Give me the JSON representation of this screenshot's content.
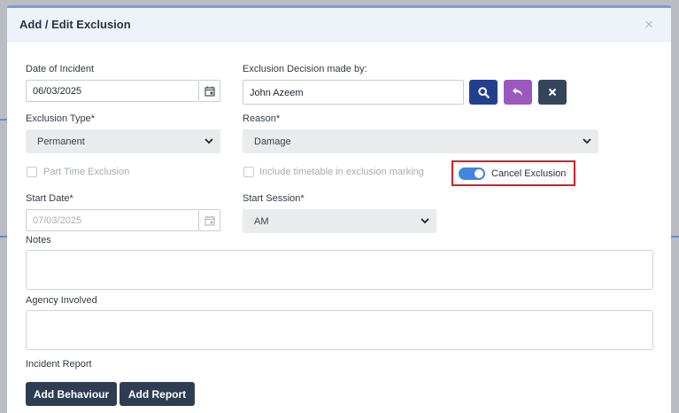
{
  "modal": {
    "title": "Add / Edit Exclusion",
    "close_symbol": "×"
  },
  "form": {
    "date_of_incident": {
      "label": "Date of Incident",
      "value": "06/03/2025"
    },
    "decision_made_by": {
      "label": "Exclusion Decision made by:",
      "value": "John Azeem"
    },
    "exclusion_type": {
      "label": "Exclusion Type*",
      "value": "Permanent"
    },
    "reason": {
      "label": "Reason*",
      "value": "Damage"
    },
    "part_time_exclusion": {
      "label": "Part Time Exclusion",
      "checked": false
    },
    "include_timetable": {
      "label": "Include timetable in exclusion marking",
      "checked": false
    },
    "cancel_exclusion": {
      "label": "Cancel Exclusion",
      "on": true
    },
    "start_date": {
      "label": "Start Date*",
      "value": "07/03/2025"
    },
    "start_session": {
      "label": "Start Session*",
      "value": "AM"
    },
    "notes": {
      "label": "Notes",
      "value": ""
    },
    "agency_involved": {
      "label": "Agency Involved",
      "value": ""
    },
    "incident_report": {
      "label": "Incident Report"
    }
  },
  "buttons": {
    "add_behaviour": "Add Behaviour",
    "add_report": "Add Report"
  },
  "colors": {
    "search_button": "#23408e",
    "undo_button": "#9b59c0",
    "clear_button": "#34445a",
    "toggle_on": "#3f86e0",
    "highlight": "#d4202a"
  }
}
